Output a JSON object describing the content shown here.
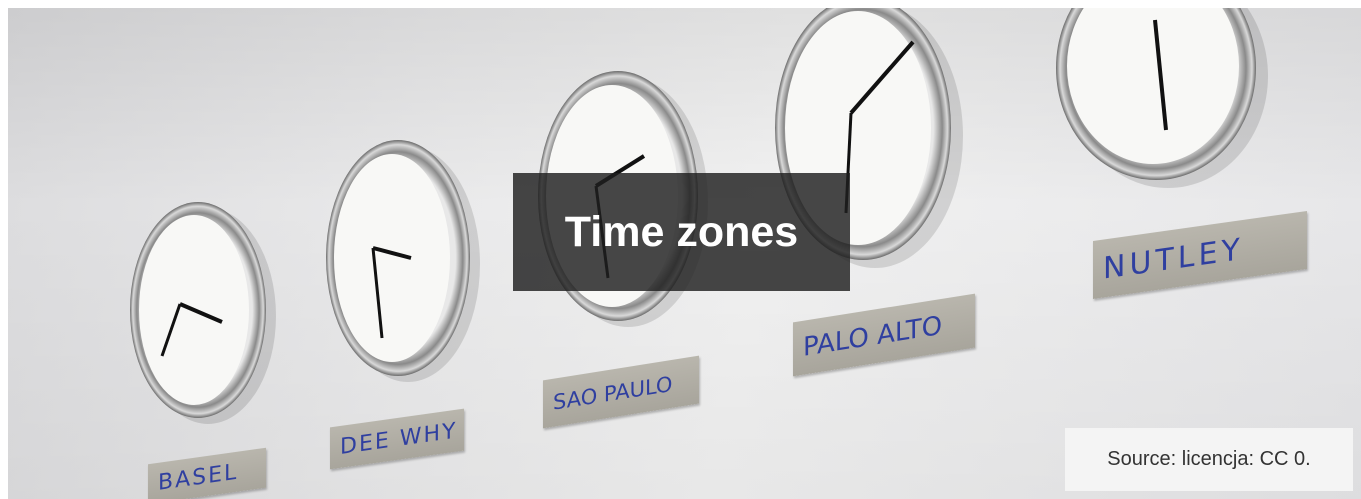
{
  "hero": {
    "title": "Time zones",
    "source": "Source: licencja: CC 0."
  },
  "clocks": [
    {
      "city": "BASEL"
    },
    {
      "city": "DEE WHY"
    },
    {
      "city": "SAO PAULO"
    },
    {
      "city": "PALO ALTO"
    },
    {
      "city": "NUTLEY"
    }
  ],
  "colors": {
    "wall": "#e9e9ea",
    "plate": "#b0ada4",
    "plate_text": "#2f3fa0",
    "title_overlay": "#1e1e1e",
    "source_bg": "#f4f4f4"
  }
}
